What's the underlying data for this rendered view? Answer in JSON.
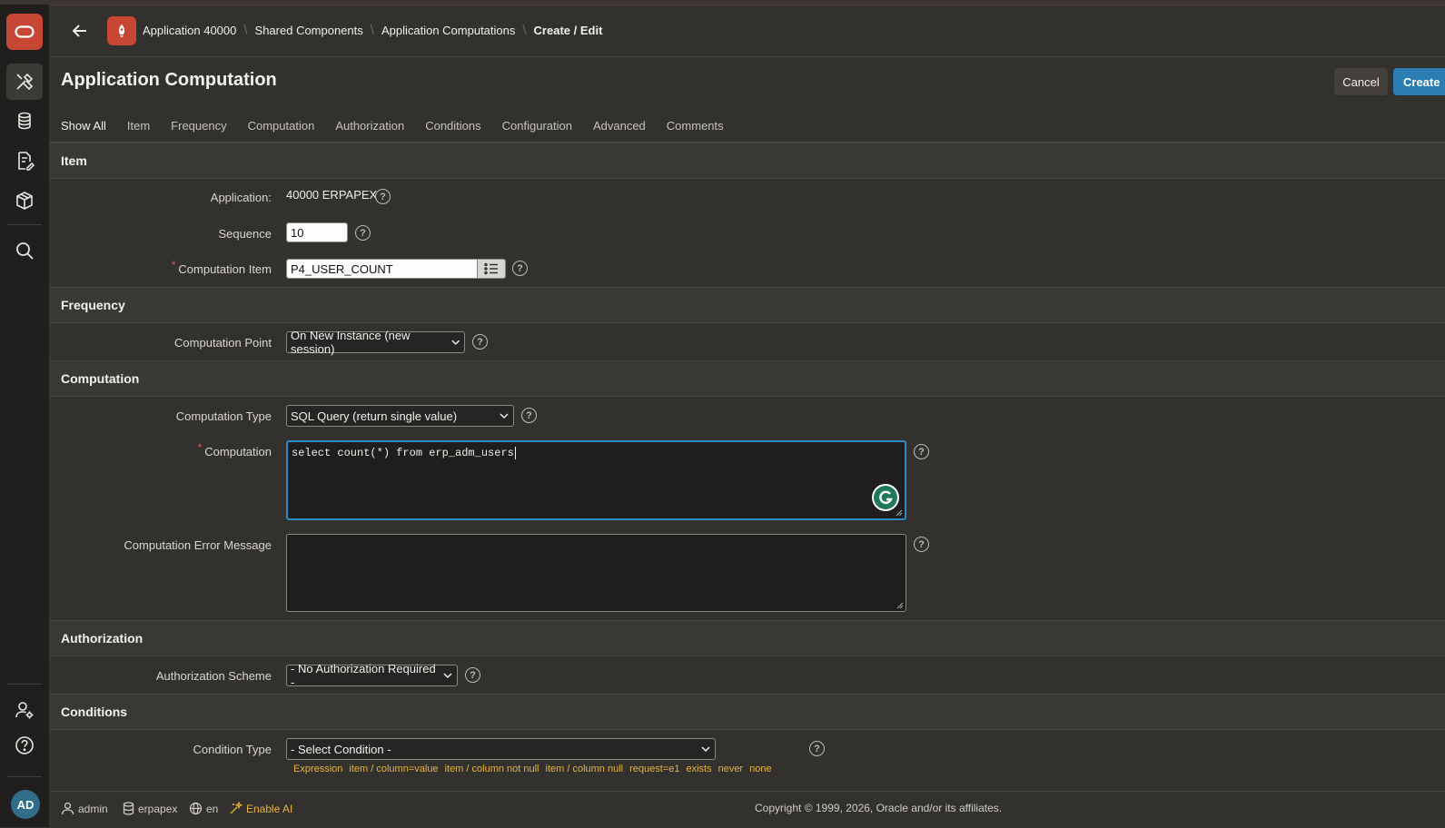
{
  "header": {
    "breadcrumbs": [
      "Application 40000",
      "Shared Components",
      "Application Computations",
      "Create / Edit"
    ]
  },
  "page": {
    "title": "Application Computation",
    "cancel_label": "Cancel",
    "create_label": "Create"
  },
  "tabs": [
    "Show All",
    "Item",
    "Frequency",
    "Computation",
    "Authorization",
    "Conditions",
    "Configuration",
    "Advanced",
    "Comments"
  ],
  "sections": {
    "item": {
      "title": "Item",
      "application_label": "Application:",
      "application_value": "40000 ERPAPEX",
      "sequence_label": "Sequence",
      "sequence_value": "10",
      "computation_item_label": "Computation Item",
      "computation_item_value": "P4_USER_COUNT"
    },
    "frequency": {
      "title": "Frequency",
      "computation_point_label": "Computation Point",
      "computation_point_value": "On New Instance (new session)"
    },
    "computation": {
      "title": "Computation",
      "type_label": "Computation Type",
      "type_value": "SQL Query (return single value)",
      "computation_label": "Computation",
      "computation_value": "select count(*) from erp_adm_users",
      "error_label": "Computation Error Message",
      "error_value": ""
    },
    "authorization": {
      "title": "Authorization",
      "scheme_label": "Authorization Scheme",
      "scheme_value": "- No Authorization Required -"
    },
    "conditions": {
      "title": "Conditions",
      "type_label": "Condition Type",
      "type_value": "- Select Condition -",
      "quick_picks": [
        "Expression",
        "item / column=value",
        "item / column not null",
        "item / column null",
        "request=e1",
        "exists",
        "never",
        "none"
      ]
    }
  },
  "footer": {
    "user": "admin",
    "schema": "erpapex",
    "language": "en",
    "ai": "Enable AI",
    "copyright": "Copyright © 1999, 2026, Oracle and/or its affiliates."
  },
  "user_avatar": "AD",
  "colors": {
    "accent": "#2a8bc8",
    "brand": "#c74634",
    "quick_pick": "#e6b33a"
  }
}
